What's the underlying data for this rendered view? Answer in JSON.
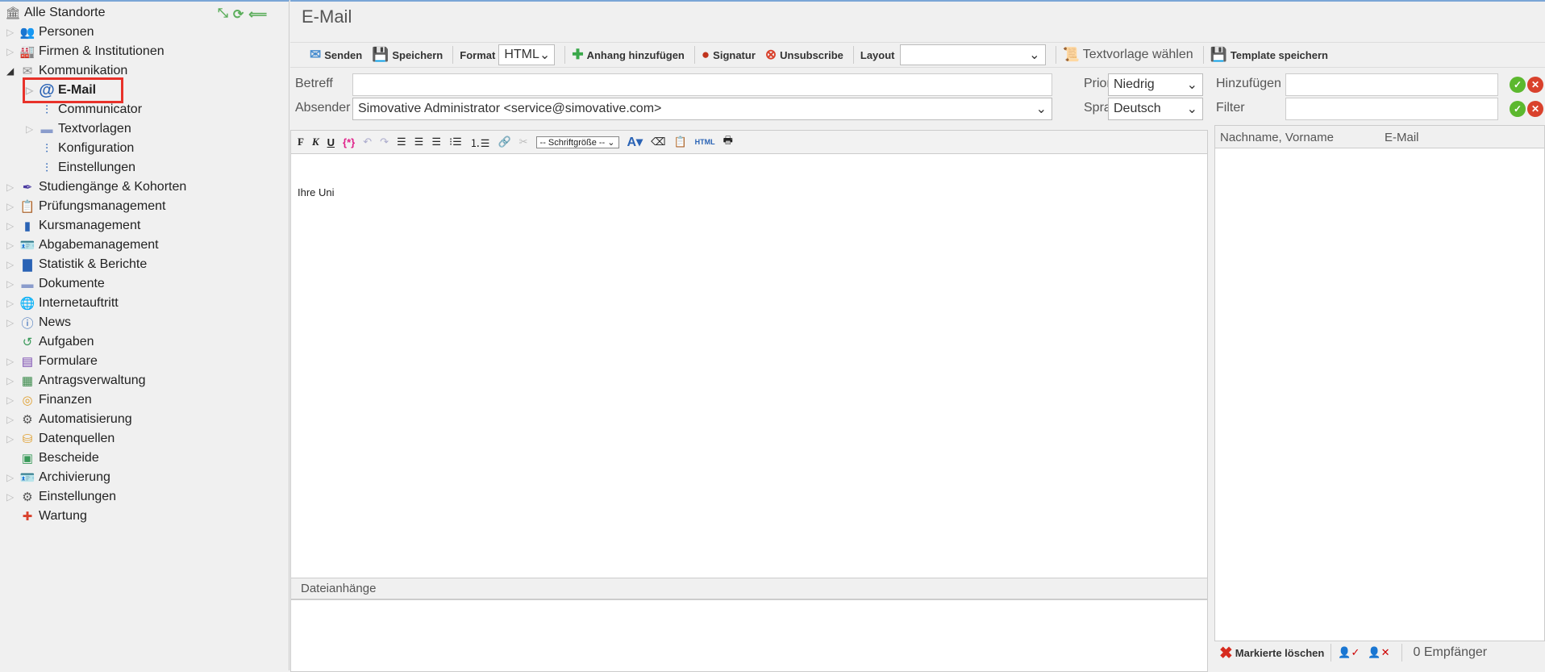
{
  "sidebar": {
    "root": "Alle Standorte",
    "items": [
      {
        "label": "Personen",
        "icon": "persons-icon",
        "expand": true,
        "level": 0
      },
      {
        "label": "Firmen & Institutionen",
        "icon": "factory-icon",
        "expand": true,
        "level": 0
      },
      {
        "label": "Kommunikation",
        "icon": "envelope-icon",
        "expand": "open",
        "level": 0
      },
      {
        "label": "E-Mail",
        "icon": "at-icon",
        "expand": true,
        "level": 1,
        "selected": true
      },
      {
        "label": "Communicator",
        "icon": "sliders-icon",
        "expand": false,
        "level": 1
      },
      {
        "label": "Textvorlagen",
        "icon": "folder-icon",
        "expand": true,
        "level": 1
      },
      {
        "label": "Konfiguration",
        "icon": "sliders-icon",
        "expand": false,
        "level": 1
      },
      {
        "label": "Einstellungen",
        "icon": "sliders-icon",
        "expand": false,
        "level": 1
      },
      {
        "label": "Studiengänge & Kohorten",
        "icon": "quill-icon",
        "expand": true,
        "level": 0
      },
      {
        "label": "Prüfungsmanagement",
        "icon": "exam-icon",
        "expand": true,
        "level": 0
      },
      {
        "label": "Kursmanagement",
        "icon": "book-icon",
        "expand": true,
        "level": 0
      },
      {
        "label": "Abgabemanagement",
        "icon": "id-card-icon",
        "expand": true,
        "level": 0
      },
      {
        "label": "Statistik & Berichte",
        "icon": "bar-chart-icon",
        "expand": true,
        "level": 0
      },
      {
        "label": "Dokumente",
        "icon": "folder-icon",
        "expand": true,
        "level": 0
      },
      {
        "label": "Internetauftritt",
        "icon": "globe-icon",
        "expand": true,
        "level": 0
      },
      {
        "label": "News",
        "icon": "info-icon",
        "expand": true,
        "level": 0
      },
      {
        "label": "Aufgaben",
        "icon": "history-icon",
        "expand": false,
        "level": 0
      },
      {
        "label": "Formulare",
        "icon": "form-icon",
        "expand": true,
        "level": 0
      },
      {
        "label": "Antragsverwaltung",
        "icon": "table-user-icon",
        "expand": true,
        "level": 0
      },
      {
        "label": "Finanzen",
        "icon": "coins-icon",
        "expand": true,
        "level": 0
      },
      {
        "label": "Automatisierung",
        "icon": "gear-icon",
        "expand": true,
        "level": 0
      },
      {
        "label": "Datenquellen",
        "icon": "database-icon",
        "expand": true,
        "level": 0
      },
      {
        "label": "Bescheide",
        "icon": "certificate-icon",
        "expand": false,
        "level": 0
      },
      {
        "label": "Archivierung",
        "icon": "id-card-icon",
        "expand": true,
        "level": 0
      },
      {
        "label": "Einstellungen",
        "icon": "gear-icon",
        "expand": true,
        "level": 0
      },
      {
        "label": "Wartung",
        "icon": "first-aid-icon",
        "expand": false,
        "level": 0
      }
    ]
  },
  "main": {
    "title": "E-Mail",
    "toolbar": {
      "send": "Senden",
      "save": "Speichern",
      "format_label": "Format",
      "format_value": "HTML",
      "attach": "Anhang hinzufügen",
      "signature": "Signatur",
      "unsubscribe": "Unsubscribe",
      "layout_label": "Layout",
      "layout_value": "",
      "template_choose": "Textvorlage wählen",
      "template_save": "Template speichern"
    },
    "form": {
      "subject_label": "Betreff",
      "subject_value": "",
      "sender_label": "Absender",
      "sender_value": "Simovative Administrator <service@simovative.com>",
      "priority_label": "Prioriät",
      "priority_value": "Niedrig",
      "language_label": "Sprache",
      "language_value": "Deutsch"
    },
    "editor": {
      "bold": "F",
      "italic": "K",
      "underline": "U",
      "placeholder_btn": "{*}",
      "fontsize": "-- Schriftgröße --",
      "html_btn": "HTML",
      "body": "Ihre Uni"
    },
    "attachments_label": "Dateianhänge"
  },
  "recipients": {
    "add_label": "Hinzufügen",
    "filter_label": "Filter",
    "col_name": "Nachname, Vorname",
    "col_email": "E-Mail",
    "delete_marked": "Markierte löschen",
    "count": "0 Empfänger"
  }
}
